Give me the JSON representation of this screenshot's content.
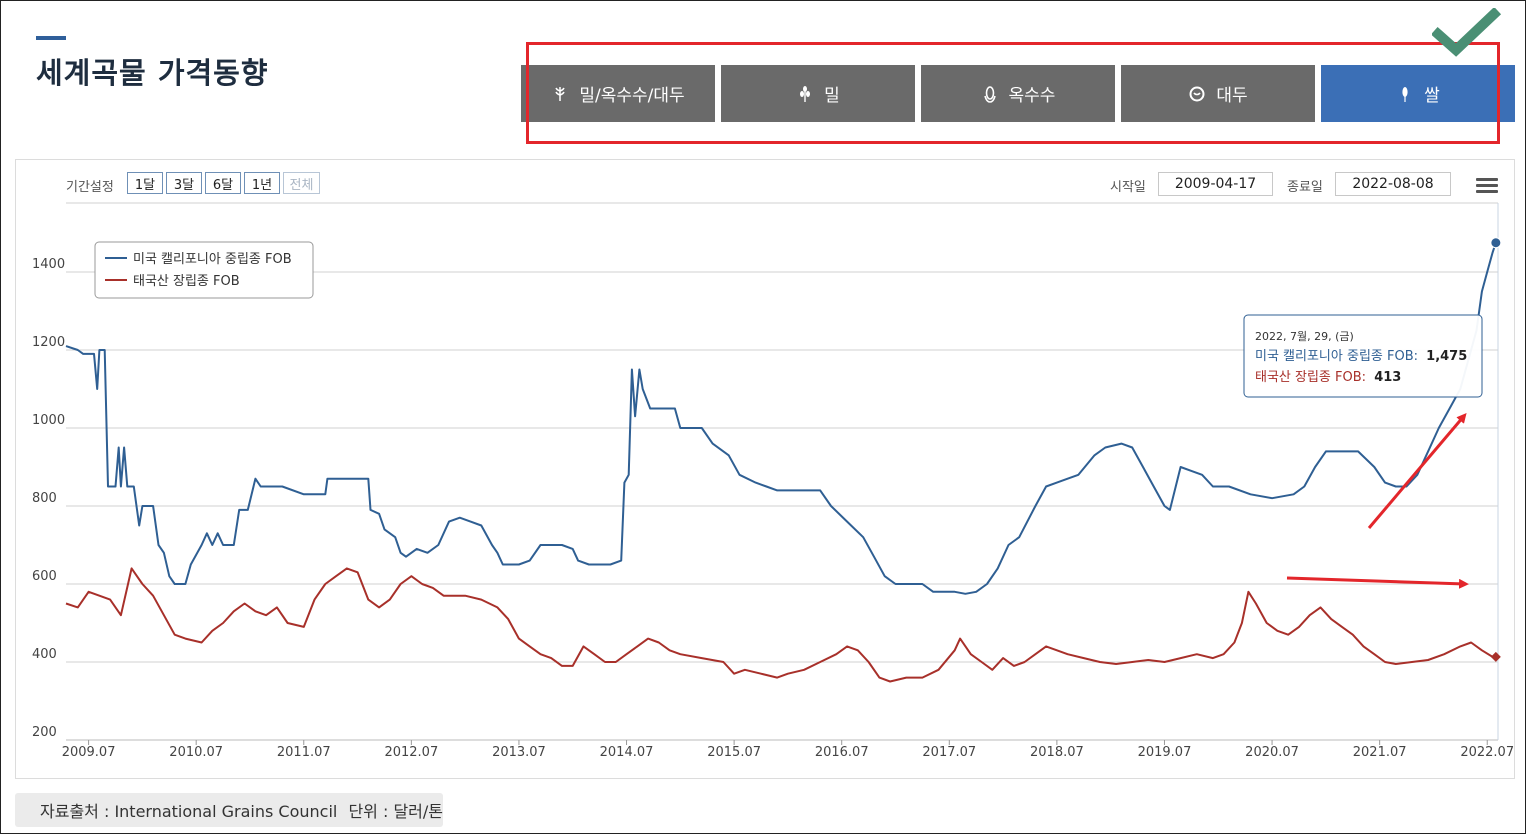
{
  "page": {
    "title": "세계곡물 가격동향"
  },
  "tabs": [
    {
      "label": "밀/옥수수/대두",
      "icon": "wheat-icon",
      "active": false
    },
    {
      "label": "밀",
      "icon": "grain-icon",
      "active": false
    },
    {
      "label": "옥수수",
      "icon": "corn-icon",
      "active": false
    },
    {
      "label": "대두",
      "icon": "soybean-icon",
      "active": false
    },
    {
      "label": "쌀",
      "icon": "rice-icon",
      "active": true
    }
  ],
  "controls": {
    "range_label": "기간설정",
    "range_buttons": [
      "1달",
      "3달",
      "6달",
      "1년",
      "전체"
    ],
    "start_label": "시작일",
    "start_value": "2009-04-17",
    "end_label": "종료일",
    "end_value": "2022-08-08"
  },
  "tooltip": {
    "date": "2022, 7월, 29, (금)",
    "series1_label": "미국 캘리포니아 중립종 FOB:",
    "series1_value": "1,475",
    "series2_label": "태국산 장립종 FOB:",
    "series2_value": "413"
  },
  "source": {
    "text": "자료출처 : International Grains Council",
    "unit": "단위 : 달러/톤"
  },
  "colors": {
    "series1": "#2f5f93",
    "series2": "#a8302a",
    "tab": "#6a6a6a",
    "tab_active": "#3b6fb6",
    "annotation": "#e3262b",
    "check": "#4a8f74"
  },
  "chart_data": {
    "type": "line",
    "ylim": [
      200,
      1500
    ],
    "yticks": [
      200,
      400,
      600,
      800,
      1000,
      1200,
      1400
    ],
    "xlim": [
      2009.29,
      2022.6
    ],
    "xticks": [
      {
        "label": "2009.07",
        "value": 2009.5
      },
      {
        "label": "2010.07",
        "value": 2010.5
      },
      {
        "label": "2011.07",
        "value": 2011.5
      },
      {
        "label": "2012.07",
        "value": 2012.5
      },
      {
        "label": "2013.07",
        "value": 2013.5
      },
      {
        "label": "2014.07",
        "value": 2014.5
      },
      {
        "label": "2015.07",
        "value": 2015.5
      },
      {
        "label": "2016.07",
        "value": 2016.5
      },
      {
        "label": "2017.07",
        "value": 2017.5
      },
      {
        "label": "2018.07",
        "value": 2018.5
      },
      {
        "label": "2019.07",
        "value": 2019.5
      },
      {
        "label": "2020.07",
        "value": 2020.5
      },
      {
        "label": "2021.07",
        "value": 2021.5
      },
      {
        "label": "2022.07",
        "value": 2022.5
      }
    ],
    "legend_position": "top-left",
    "series": [
      {
        "name": "미국 캘리포니아 중립종 FOB",
        "points": [
          [
            2009.29,
            1210
          ],
          [
            2009.4,
            1200
          ],
          [
            2009.45,
            1190
          ],
          [
            2009.55,
            1190
          ],
          [
            2009.58,
            1100
          ],
          [
            2009.6,
            1200
          ],
          [
            2009.65,
            1200
          ],
          [
            2009.68,
            850
          ],
          [
            2009.75,
            850
          ],
          [
            2009.78,
            950
          ],
          [
            2009.8,
            850
          ],
          [
            2009.83,
            950
          ],
          [
            2009.86,
            850
          ],
          [
            2009.92,
            850
          ],
          [
            2009.97,
            750
          ],
          [
            2010.0,
            800
          ],
          [
            2010.1,
            800
          ],
          [
            2010.15,
            700
          ],
          [
            2010.2,
            680
          ],
          [
            2010.25,
            620
          ],
          [
            2010.3,
            600
          ],
          [
            2010.4,
            600
          ],
          [
            2010.45,
            650
          ],
          [
            2010.55,
            700
          ],
          [
            2010.6,
            730
          ],
          [
            2010.65,
            700
          ],
          [
            2010.7,
            730
          ],
          [
            2010.75,
            700
          ],
          [
            2010.85,
            700
          ],
          [
            2010.9,
            790
          ],
          [
            2010.98,
            790
          ],
          [
            2011.05,
            870
          ],
          [
            2011.1,
            850
          ],
          [
            2011.3,
            850
          ],
          [
            2011.5,
            830
          ],
          [
            2011.7,
            830
          ],
          [
            2011.72,
            870
          ],
          [
            2011.9,
            870
          ],
          [
            2012.1,
            870
          ],
          [
            2012.12,
            790
          ],
          [
            2012.2,
            780
          ],
          [
            2012.25,
            740
          ],
          [
            2012.35,
            720
          ],
          [
            2012.4,
            680
          ],
          [
            2012.45,
            670
          ],
          [
            2012.55,
            690
          ],
          [
            2012.65,
            680
          ],
          [
            2012.75,
            700
          ],
          [
            2012.85,
            760
          ],
          [
            2012.95,
            770
          ],
          [
            2013.05,
            760
          ],
          [
            2013.15,
            750
          ],
          [
            2013.25,
            700
          ],
          [
            2013.3,
            680
          ],
          [
            2013.35,
            650
          ],
          [
            2013.5,
            650
          ],
          [
            2013.6,
            660
          ],
          [
            2013.7,
            700
          ],
          [
            2013.8,
            700
          ],
          [
            2013.9,
            700
          ],
          [
            2014.0,
            690
          ],
          [
            2014.05,
            660
          ],
          [
            2014.15,
            650
          ],
          [
            2014.25,
            650
          ],
          [
            2014.35,
            650
          ],
          [
            2014.45,
            660
          ],
          [
            2014.48,
            860
          ],
          [
            2014.52,
            880
          ],
          [
            2014.55,
            1150
          ],
          [
            2014.58,
            1030
          ],
          [
            2014.62,
            1150
          ],
          [
            2014.65,
            1100
          ],
          [
            2014.72,
            1050
          ],
          [
            2014.95,
            1050
          ],
          [
            2015.0,
            1000
          ],
          [
            2015.2,
            1000
          ],
          [
            2015.3,
            960
          ],
          [
            2015.45,
            930
          ],
          [
            2015.55,
            880
          ],
          [
            2015.7,
            860
          ],
          [
            2015.8,
            850
          ],
          [
            2015.9,
            840
          ],
          [
            2016.1,
            840
          ],
          [
            2016.3,
            840
          ],
          [
            2016.4,
            800
          ],
          [
            2016.55,
            760
          ],
          [
            2016.7,
            720
          ],
          [
            2016.8,
            670
          ],
          [
            2016.9,
            620
          ],
          [
            2017.0,
            600
          ],
          [
            2017.15,
            600
          ],
          [
            2017.25,
            600
          ],
          [
            2017.35,
            580
          ],
          [
            2017.45,
            580
          ],
          [
            2017.55,
            580
          ],
          [
            2017.65,
            575
          ],
          [
            2017.75,
            580
          ],
          [
            2017.85,
            600
          ],
          [
            2017.95,
            640
          ],
          [
            2018.05,
            700
          ],
          [
            2018.15,
            720
          ],
          [
            2018.3,
            800
          ],
          [
            2018.4,
            850
          ],
          [
            2018.5,
            860
          ],
          [
            2018.6,
            870
          ],
          [
            2018.7,
            880
          ],
          [
            2018.85,
            930
          ],
          [
            2018.95,
            950
          ],
          [
            2019.1,
            960
          ],
          [
            2019.2,
            950
          ],
          [
            2019.3,
            900
          ],
          [
            2019.4,
            850
          ],
          [
            2019.5,
            800
          ],
          [
            2019.55,
            790
          ],
          [
            2019.65,
            900
          ],
          [
            2019.75,
            890
          ],
          [
            2019.85,
            880
          ],
          [
            2019.95,
            850
          ],
          [
            2020.1,
            850
          ],
          [
            2020.3,
            830
          ],
          [
            2020.5,
            820
          ],
          [
            2020.7,
            830
          ],
          [
            2020.8,
            850
          ],
          [
            2020.9,
            900
          ],
          [
            2021.0,
            940
          ],
          [
            2021.15,
            940
          ],
          [
            2021.3,
            940
          ],
          [
            2021.45,
            900
          ],
          [
            2021.55,
            860
          ],
          [
            2021.65,
            850
          ],
          [
            2021.75,
            850
          ],
          [
            2021.85,
            880
          ],
          [
            2021.95,
            940
          ],
          [
            2022.05,
            1000
          ],
          [
            2022.15,
            1050
          ],
          [
            2022.25,
            1100
          ],
          [
            2022.35,
            1200
          ],
          [
            2022.4,
            1250
          ],
          [
            2022.45,
            1350
          ],
          [
            2022.5,
            1400
          ],
          [
            2022.55,
            1450
          ],
          [
            2022.58,
            1475
          ]
        ]
      },
      {
        "name": "태국산 장립종 FOB",
        "points": [
          [
            2009.29,
            550
          ],
          [
            2009.4,
            540
          ],
          [
            2009.5,
            580
          ],
          [
            2009.6,
            570
          ],
          [
            2009.7,
            560
          ],
          [
            2009.8,
            520
          ],
          [
            2009.9,
            640
          ],
          [
            2010.0,
            600
          ],
          [
            2010.1,
            570
          ],
          [
            2010.2,
            520
          ],
          [
            2010.3,
            470
          ],
          [
            2010.4,
            460
          ],
          [
            2010.55,
            450
          ],
          [
            2010.65,
            480
          ],
          [
            2010.75,
            500
          ],
          [
            2010.85,
            530
          ],
          [
            2010.95,
            550
          ],
          [
            2011.05,
            530
          ],
          [
            2011.15,
            520
          ],
          [
            2011.25,
            540
          ],
          [
            2011.35,
            500
          ],
          [
            2011.5,
            490
          ],
          [
            2011.6,
            560
          ],
          [
            2011.7,
            600
          ],
          [
            2011.8,
            620
          ],
          [
            2011.9,
            640
          ],
          [
            2012.0,
            630
          ],
          [
            2012.1,
            560
          ],
          [
            2012.2,
            540
          ],
          [
            2012.3,
            560
          ],
          [
            2012.4,
            600
          ],
          [
            2012.5,
            620
          ],
          [
            2012.6,
            600
          ],
          [
            2012.7,
            590
          ],
          [
            2012.8,
            570
          ],
          [
            2012.9,
            570
          ],
          [
            2013.0,
            570
          ],
          [
            2013.15,
            560
          ],
          [
            2013.3,
            540
          ],
          [
            2013.4,
            510
          ],
          [
            2013.5,
            460
          ],
          [
            2013.6,
            440
          ],
          [
            2013.7,
            420
          ],
          [
            2013.8,
            410
          ],
          [
            2013.9,
            390
          ],
          [
            2014.0,
            390
          ],
          [
            2014.1,
            440
          ],
          [
            2014.2,
            420
          ],
          [
            2014.3,
            400
          ],
          [
            2014.4,
            400
          ],
          [
            2014.5,
            420
          ],
          [
            2014.6,
            440
          ],
          [
            2014.7,
            460
          ],
          [
            2014.8,
            450
          ],
          [
            2014.9,
            430
          ],
          [
            2015.0,
            420
          ],
          [
            2015.2,
            410
          ],
          [
            2015.4,
            400
          ],
          [
            2015.5,
            370
          ],
          [
            2015.6,
            380
          ],
          [
            2015.75,
            370
          ],
          [
            2015.9,
            360
          ],
          [
            2016.0,
            370
          ],
          [
            2016.15,
            380
          ],
          [
            2016.3,
            400
          ],
          [
            2016.45,
            420
          ],
          [
            2016.55,
            440
          ],
          [
            2016.65,
            430
          ],
          [
            2016.75,
            400
          ],
          [
            2016.85,
            360
          ],
          [
            2016.95,
            350
          ],
          [
            2017.1,
            360
          ],
          [
            2017.25,
            360
          ],
          [
            2017.4,
            380
          ],
          [
            2017.55,
            430
          ],
          [
            2017.6,
            460
          ],
          [
            2017.7,
            420
          ],
          [
            2017.8,
            400
          ],
          [
            2017.9,
            380
          ],
          [
            2018.0,
            410
          ],
          [
            2018.1,
            390
          ],
          [
            2018.2,
            400
          ],
          [
            2018.3,
            420
          ],
          [
            2018.4,
            440
          ],
          [
            2018.5,
            430
          ],
          [
            2018.6,
            420
          ],
          [
            2018.75,
            410
          ],
          [
            2018.9,
            400
          ],
          [
            2019.05,
            395
          ],
          [
            2019.2,
            400
          ],
          [
            2019.35,
            405
          ],
          [
            2019.5,
            400
          ],
          [
            2019.65,
            410
          ],
          [
            2019.8,
            420
          ],
          [
            2019.95,
            410
          ],
          [
            2020.05,
            420
          ],
          [
            2020.15,
            450
          ],
          [
            2020.22,
            500
          ],
          [
            2020.28,
            580
          ],
          [
            2020.35,
            550
          ],
          [
            2020.45,
            500
          ],
          [
            2020.55,
            480
          ],
          [
            2020.65,
            470
          ],
          [
            2020.75,
            490
          ],
          [
            2020.85,
            520
          ],
          [
            2020.95,
            540
          ],
          [
            2021.05,
            510
          ],
          [
            2021.15,
            490
          ],
          [
            2021.25,
            470
          ],
          [
            2021.35,
            440
          ],
          [
            2021.45,
            420
          ],
          [
            2021.55,
            400
          ],
          [
            2021.65,
            395
          ],
          [
            2021.8,
            400
          ],
          [
            2021.95,
            405
          ],
          [
            2022.1,
            420
          ],
          [
            2022.25,
            440
          ],
          [
            2022.35,
            450
          ],
          [
            2022.45,
            430
          ],
          [
            2022.55,
            413
          ],
          [
            2022.58,
            413
          ]
        ]
      }
    ]
  }
}
